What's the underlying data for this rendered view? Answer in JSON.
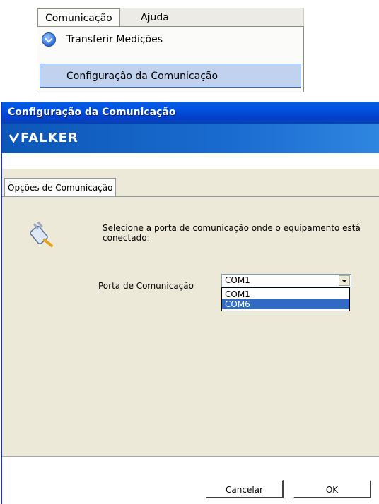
{
  "menu": {
    "bar": [
      "Comunicação",
      "Ajuda"
    ],
    "items": [
      {
        "label": "Transferir Medições",
        "icon": "download-arrow-icon"
      },
      {
        "label": "Configuração da Comunicação",
        "highlighted": true
      }
    ]
  },
  "dialog": {
    "title": "Configuração da Comunicação",
    "brand": "FALKER",
    "tab": "Opções de Comunicação",
    "instruction": "Selecione a porta de comunicação onde o equipamento está conectado:",
    "porta_label": "Porta de Comunicação",
    "combo_value": "COM1",
    "options": [
      "COM1",
      "COM6"
    ],
    "selected_option": "COM6",
    "buttons": {
      "cancel": "Cancelar",
      "ok": "OK"
    }
  },
  "colors": {
    "titlebar": "#0058e6",
    "selection": "#316ac5",
    "menu_highlight": "#c1d2ee"
  }
}
